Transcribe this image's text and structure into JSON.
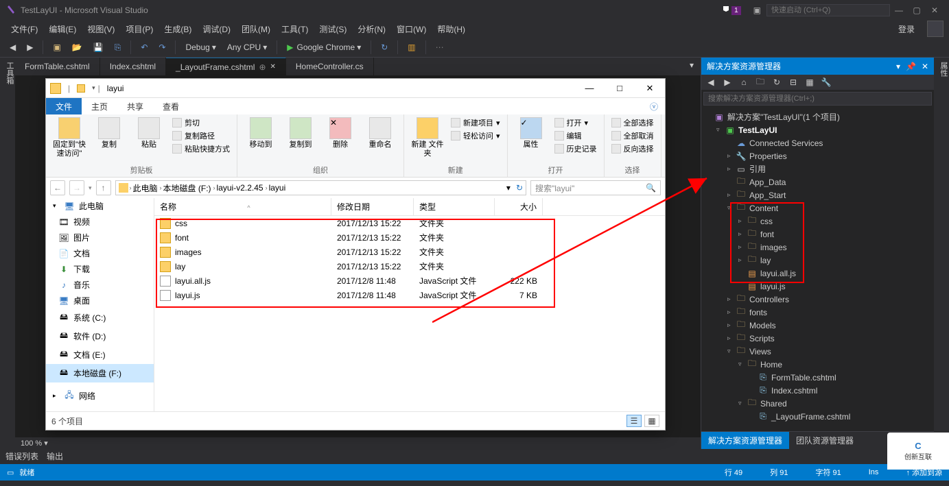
{
  "app": {
    "title": "TestLayUI - Microsoft Visual Studio",
    "quick_launch_placeholder": "快速启动 (Ctrl+Q)",
    "notification_badge": "1",
    "login_label": "登录"
  },
  "menubar": {
    "file": "文件(F)",
    "edit": "编辑(E)",
    "view": "视图(V)",
    "project": "项目(P)",
    "build": "生成(B)",
    "debug": "调试(D)",
    "team": "团队(M)",
    "tools": "工具(T)",
    "test": "测试(S)",
    "analyze": "分析(N)",
    "window": "窗口(W)",
    "help": "帮助(H)"
  },
  "toolbar": {
    "config": "Debug",
    "platform": "Any CPU",
    "browser": "Google Chrome"
  },
  "tabs": [
    {
      "label": "FormTable.cshtml",
      "active": false
    },
    {
      "label": "Index.cshtml",
      "active": false
    },
    {
      "label": "_LayoutFrame.cshtml",
      "active": true
    },
    {
      "label": "HomeController.cs",
      "active": false
    }
  ],
  "zoom": "100 %",
  "bottom_panels": {
    "errors": "错误列表",
    "output": "输出"
  },
  "left_tool": "工具箱",
  "right_tool": "属性",
  "solution": {
    "panel_title": "解决方案资源管理器",
    "search_placeholder": "搜索解决方案资源管理器(Ctrl+;)",
    "root_label": "解决方案\"TestLayUI\"(1 个项目)",
    "project": "TestLayUI",
    "items": {
      "connected_services": "Connected Services",
      "properties": "Properties",
      "references": "引用",
      "app_data": "App_Data",
      "app_start": "App_Start",
      "content": "Content",
      "css": "css",
      "font": "font",
      "images": "images",
      "lay": "lay",
      "layui_all_js": "layui.all.js",
      "layui_js": "layui.js",
      "controllers": "Controllers",
      "fonts": "fonts",
      "models": "Models",
      "scripts": "Scripts",
      "views": "Views",
      "home": "Home",
      "formtable": "FormTable.cshtml",
      "index": "Index.cshtml",
      "shared": "Shared",
      "layoutframe": "_LayoutFrame.cshtml"
    },
    "footer_active": "解决方案资源管理器",
    "footer_other": "团队资源管理器"
  },
  "statusbar": {
    "ready": "就绪",
    "line": "行 49",
    "col": "列 91",
    "char": "字符 91",
    "ins": "Ins",
    "add_src": "添加到源"
  },
  "logo": "创新互联",
  "explorer": {
    "path_label": "layui",
    "tabs": {
      "file": "文件",
      "home": "主页",
      "share": "共享",
      "view": "查看"
    },
    "ribbon": {
      "clipboard_label": "剪贴板",
      "organize_label": "组织",
      "new_label": "新建",
      "open_label": "打开",
      "select_label": "选择",
      "pin": "固定到\"快\n速访问\"",
      "copy": "复制",
      "paste": "粘贴",
      "cut": "剪切",
      "copy_path": "复制路径",
      "paste_shortcut": "粘贴快捷方式",
      "moveto": "移动到",
      "copyto": "复制到",
      "delete": "删除",
      "rename": "重命名",
      "new_folder": "新建\n文件夹",
      "new_item": "新建项目",
      "easy_access": "轻松访问",
      "properties": "属性",
      "open_btn": "打开",
      "edit": "编辑",
      "history": "历史记录",
      "select_all": "全部选择",
      "select_none": "全部取消",
      "invert": "反向选择"
    },
    "breadcrumbs": [
      "此电脑",
      "本地磁盘 (F:)",
      "layui-v2.2.45",
      "layui"
    ],
    "search_placeholder": "搜索\"layui\"",
    "nav": {
      "this_pc": "此电脑",
      "videos": "视频",
      "pictures": "图片",
      "documents": "文档",
      "downloads": "下载",
      "music": "音乐",
      "desktop": "桌面",
      "sys_c": "系统 (C:)",
      "soft_d": "软件 (D:)",
      "doc_e": "文档 (E:)",
      "local_f": "本地磁盘 (F:)",
      "network": "网络"
    },
    "columns": {
      "name": "名称",
      "date": "修改日期",
      "type": "类型",
      "size": "大小"
    },
    "rows": [
      {
        "name": "css",
        "date": "2017/12/13 15:22",
        "type": "文件夹",
        "size": "",
        "icon": "folder"
      },
      {
        "name": "font",
        "date": "2017/12/13 15:22",
        "type": "文件夹",
        "size": "",
        "icon": "folder"
      },
      {
        "name": "images",
        "date": "2017/12/13 15:22",
        "type": "文件夹",
        "size": "",
        "icon": "folder"
      },
      {
        "name": "lay",
        "date": "2017/12/13 15:22",
        "type": "文件夹",
        "size": "",
        "icon": "folder"
      },
      {
        "name": "layui.all.js",
        "date": "2017/12/8 11:48",
        "type": "JavaScript 文件",
        "size": "222 KB",
        "icon": "js"
      },
      {
        "name": "layui.js",
        "date": "2017/12/8 11:48",
        "type": "JavaScript 文件",
        "size": "7 KB",
        "icon": "js"
      }
    ],
    "status": "6 个项目"
  }
}
